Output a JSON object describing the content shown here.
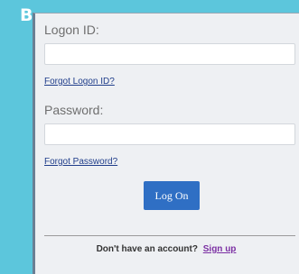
{
  "badge": "B",
  "form": {
    "logon_label": "Logon ID:",
    "forgot_logon": "Forgot Logon ID?",
    "password_label": "Password:",
    "forgot_password": "Forgot Password?",
    "logon_button": "Log On",
    "no_account_text": "Don't have an account?",
    "signup_link": "Sign up"
  }
}
